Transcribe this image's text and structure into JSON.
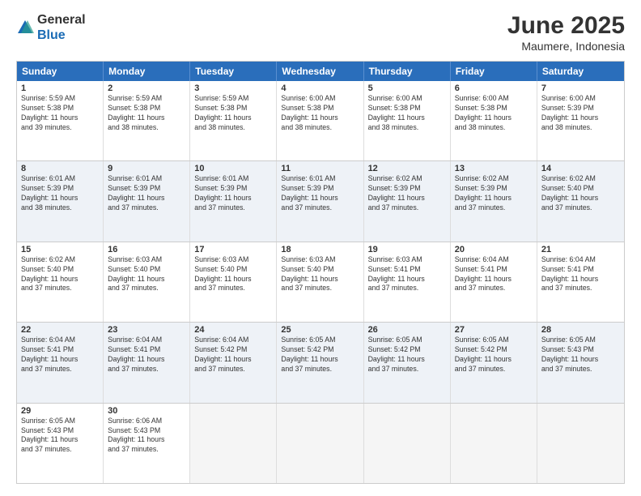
{
  "logo": {
    "general": "General",
    "blue": "Blue"
  },
  "title": "June 2025",
  "subtitle": "Maumere, Indonesia",
  "header_days": [
    "Sunday",
    "Monday",
    "Tuesday",
    "Wednesday",
    "Thursday",
    "Friday",
    "Saturday"
  ],
  "rows": [
    [
      {
        "day": "",
        "info": ""
      },
      {
        "day": "2",
        "info": "Sunrise: 5:59 AM\nSunset: 5:38 PM\nDaylight: 11 hours\nand 38 minutes."
      },
      {
        "day": "3",
        "info": "Sunrise: 5:59 AM\nSunset: 5:38 PM\nDaylight: 11 hours\nand 38 minutes."
      },
      {
        "day": "4",
        "info": "Sunrise: 6:00 AM\nSunset: 5:38 PM\nDaylight: 11 hours\nand 38 minutes."
      },
      {
        "day": "5",
        "info": "Sunrise: 6:00 AM\nSunset: 5:38 PM\nDaylight: 11 hours\nand 38 minutes."
      },
      {
        "day": "6",
        "info": "Sunrise: 6:00 AM\nSunset: 5:38 PM\nDaylight: 11 hours\nand 38 minutes."
      },
      {
        "day": "7",
        "info": "Sunrise: 6:00 AM\nSunset: 5:39 PM\nDaylight: 11 hours\nand 38 minutes."
      }
    ],
    [
      {
        "day": "1",
        "info": "Sunrise: 5:59 AM\nSunset: 5:38 PM\nDaylight: 11 hours\nand 39 minutes."
      },
      {
        "day": "9",
        "info": "Sunrise: 6:01 AM\nSunset: 5:39 PM\nDaylight: 11 hours\nand 37 minutes."
      },
      {
        "day": "10",
        "info": "Sunrise: 6:01 AM\nSunset: 5:39 PM\nDaylight: 11 hours\nand 37 minutes."
      },
      {
        "day": "11",
        "info": "Sunrise: 6:01 AM\nSunset: 5:39 PM\nDaylight: 11 hours\nand 37 minutes."
      },
      {
        "day": "12",
        "info": "Sunrise: 6:02 AM\nSunset: 5:39 PM\nDaylight: 11 hours\nand 37 minutes."
      },
      {
        "day": "13",
        "info": "Sunrise: 6:02 AM\nSunset: 5:39 PM\nDaylight: 11 hours\nand 37 minutes."
      },
      {
        "day": "14",
        "info": "Sunrise: 6:02 AM\nSunset: 5:40 PM\nDaylight: 11 hours\nand 37 minutes."
      }
    ],
    [
      {
        "day": "8",
        "info": "Sunrise: 6:01 AM\nSunset: 5:39 PM\nDaylight: 11 hours\nand 38 minutes."
      },
      {
        "day": "16",
        "info": "Sunrise: 6:03 AM\nSunset: 5:40 PM\nDaylight: 11 hours\nand 37 minutes."
      },
      {
        "day": "17",
        "info": "Sunrise: 6:03 AM\nSunset: 5:40 PM\nDaylight: 11 hours\nand 37 minutes."
      },
      {
        "day": "18",
        "info": "Sunrise: 6:03 AM\nSunset: 5:40 PM\nDaylight: 11 hours\nand 37 minutes."
      },
      {
        "day": "19",
        "info": "Sunrise: 6:03 AM\nSunset: 5:41 PM\nDaylight: 11 hours\nand 37 minutes."
      },
      {
        "day": "20",
        "info": "Sunrise: 6:04 AM\nSunset: 5:41 PM\nDaylight: 11 hours\nand 37 minutes."
      },
      {
        "day": "21",
        "info": "Sunrise: 6:04 AM\nSunset: 5:41 PM\nDaylight: 11 hours\nand 37 minutes."
      }
    ],
    [
      {
        "day": "15",
        "info": "Sunrise: 6:02 AM\nSunset: 5:40 PM\nDaylight: 11 hours\nand 37 minutes."
      },
      {
        "day": "23",
        "info": "Sunrise: 6:04 AM\nSunset: 5:41 PM\nDaylight: 11 hours\nand 37 minutes."
      },
      {
        "day": "24",
        "info": "Sunrise: 6:04 AM\nSunset: 5:42 PM\nDaylight: 11 hours\nand 37 minutes."
      },
      {
        "day": "25",
        "info": "Sunrise: 6:05 AM\nSunset: 5:42 PM\nDaylight: 11 hours\nand 37 minutes."
      },
      {
        "day": "26",
        "info": "Sunrise: 6:05 AM\nSunset: 5:42 PM\nDaylight: 11 hours\nand 37 minutes."
      },
      {
        "day": "27",
        "info": "Sunrise: 6:05 AM\nSunset: 5:42 PM\nDaylight: 11 hours\nand 37 minutes."
      },
      {
        "day": "28",
        "info": "Sunrise: 6:05 AM\nSunset: 5:43 PM\nDaylight: 11 hours\nand 37 minutes."
      }
    ],
    [
      {
        "day": "22",
        "info": "Sunrise: 6:04 AM\nSunset: 5:41 PM\nDaylight: 11 hours\nand 37 minutes."
      },
      {
        "day": "30",
        "info": "Sunrise: 6:06 AM\nSunset: 5:43 PM\nDaylight: 11 hours\nand 37 minutes."
      },
      {
        "day": "",
        "info": ""
      },
      {
        "day": "",
        "info": ""
      },
      {
        "day": "",
        "info": ""
      },
      {
        "day": "",
        "info": ""
      },
      {
        "day": "",
        "info": ""
      }
    ],
    [
      {
        "day": "29",
        "info": "Sunrise: 6:05 AM\nSunset: 5:43 PM\nDaylight: 11 hours\nand 37 minutes."
      },
      {
        "day": "",
        "info": ""
      },
      {
        "day": "",
        "info": ""
      },
      {
        "day": "",
        "info": ""
      },
      {
        "day": "",
        "info": ""
      },
      {
        "day": "",
        "info": ""
      },
      {
        "day": "",
        "info": ""
      }
    ]
  ],
  "row_styles": [
    "white",
    "alt",
    "white",
    "alt",
    "white",
    "white"
  ]
}
